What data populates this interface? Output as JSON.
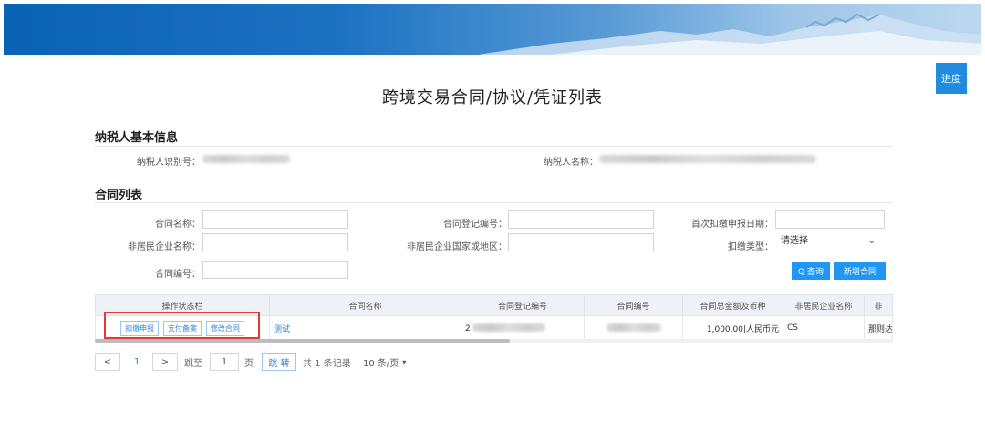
{
  "header": {
    "progress_button": "进度"
  },
  "page": {
    "title": "跨境交易合同/协议/凭证列表"
  },
  "taxpayer": {
    "section_title": "纳税人基本信息",
    "id_label": "纳税人识别号：",
    "name_label": "纳税人名称："
  },
  "contracts": {
    "section_title": "合同列表",
    "filters": {
      "contract_name": "合同名称：",
      "reg_no": "合同登记编号：",
      "first_date": "首次扣缴申报日期：",
      "nonresident_name": "非居民企业名称：",
      "nonresident_country": "非居民企业国家或地区：",
      "withhold_type": "扣缴类型：",
      "withhold_type_value": "请选择",
      "contract_no": "合同编号："
    },
    "buttons": {
      "search": "Q 查询",
      "add": "新增合同"
    },
    "columns": [
      "操作状态栏",
      "合同名称",
      "合同登记编号",
      "合同编号",
      "合同总金额及币种",
      "非居民企业名称",
      "非"
    ],
    "row": {
      "ops": [
        "扣缴申报",
        "支付备案",
        "修改合同"
      ],
      "name": "测试",
      "reg_no_prefix": "2",
      "amount": "1,000.00|人民币元",
      "nonresident": "CS",
      "extra": "那则达"
    }
  },
  "pagination": {
    "prev": "<",
    "page": "1",
    "next": ">",
    "goto_label": "跳至",
    "goto_value": "1",
    "page_unit": "页",
    "jump": "跳 转",
    "total": "共 1 条记录",
    "per_page": "10 条/页"
  }
}
